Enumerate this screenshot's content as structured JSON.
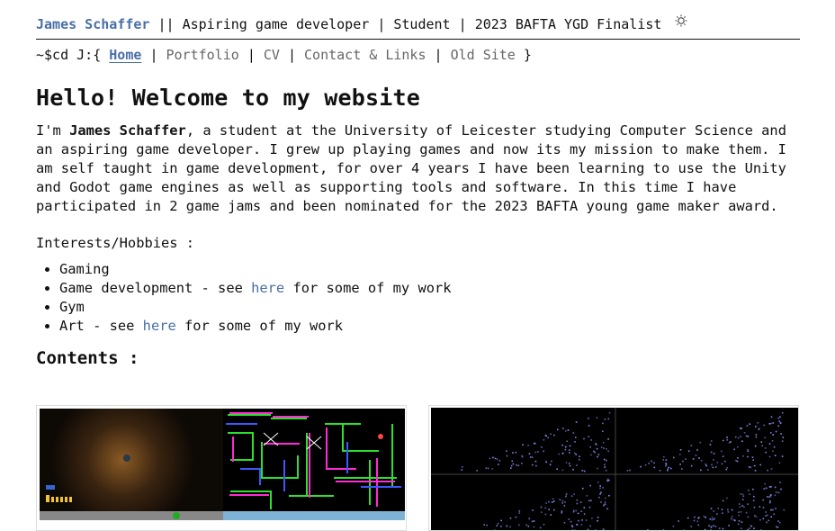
{
  "header": {
    "name": "James Schaffer",
    "separator": "||",
    "tagline_1": "Aspiring game developer",
    "tagline_2": "Student",
    "tagline_3": "2023 BAFTA YGD Finalist",
    "divider": "|",
    "theme_toggle_icon": "sun-icon"
  },
  "nav": {
    "prompt": "~$cd J:{",
    "items": [
      {
        "label": "Home",
        "active": true
      },
      {
        "label": "Portfolio"
      },
      {
        "label": "CV"
      },
      {
        "label": "Contact & Links"
      },
      {
        "label": "Old Site"
      }
    ],
    "close": "}",
    "divider": "|"
  },
  "main": {
    "title": "Hello! Welcome to my website",
    "intro_pre": "I'm ",
    "intro_name": "James Schaffer",
    "intro_post": ", a student at the University of Leicester studying Computer Science and an aspiring game developer. I grew up playing games and now its my mission to make them. I am self taught in game development, for over 4 years I have been learning to use the Unity and Godot game engines as well as supporting tools and software. In this time I have participated in 2 game jams and been nominated for the 2023 BAFTA young game maker award.",
    "interests_title": "Interests/Hobbies :",
    "interests": [
      {
        "text": "Gaming"
      },
      {
        "pre": "Game development - see ",
        "link": "here",
        "post": " for some of my work"
      },
      {
        "text": "Gym"
      },
      {
        "pre": "Art - see ",
        "link": "here",
        "post": " for some of my work"
      }
    ],
    "contents_title": "Contents :"
  },
  "colors": {
    "link": "#4a6fa5",
    "text": "#111111",
    "nav_inactive": "#666666"
  }
}
